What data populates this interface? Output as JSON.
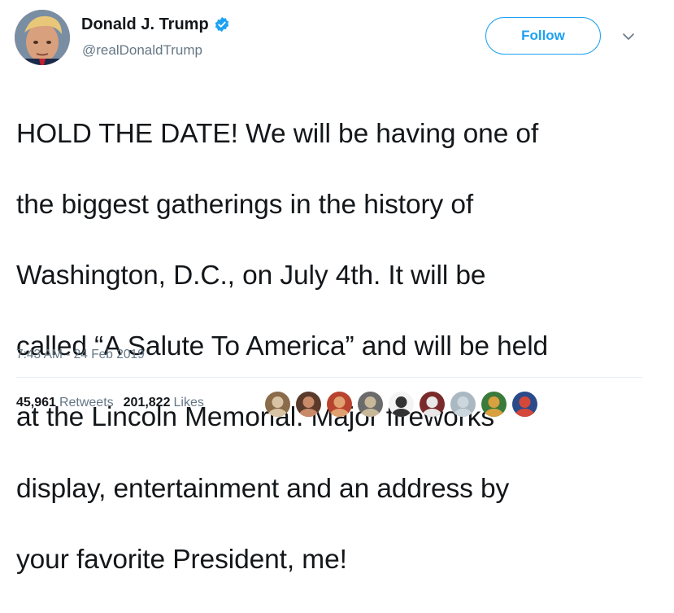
{
  "tweet": {
    "display_name": "Donald J. Trump",
    "handle": "@realDonaldTrump",
    "follow_label": "Follow",
    "text_lines": [
      "HOLD THE DATE! We will be having one of",
      "the biggest gatherings in the history of",
      "Washington, D.C., on July 4th. It will be",
      "called “A Salute To America” and will be held",
      "at the Lincoln Memorial. Major fireworks",
      "display, entertainment and an address by",
      "your favorite President, me!"
    ],
    "timestamp": "7:43 AM - 24 Feb 2019",
    "retweets_count": "45,961",
    "retweets_label": "Retweets",
    "likes_count": "201,822",
    "likes_label": "Likes"
  },
  "colors": {
    "accent": "#1da1f2",
    "text": "#14171a",
    "secondary_text": "#657786",
    "divider": "#e6ecf0"
  },
  "icons": {
    "verified": "verified-badge-icon",
    "caret": "chevron-down-icon"
  },
  "liker_avatars": [
    {
      "palette": [
        "#8a6b4a",
        "#d9c3a5"
      ]
    },
    {
      "palette": [
        "#5a3a2a",
        "#c98a6a"
      ]
    },
    {
      "palette": [
        "#b8432e",
        "#e0a070"
      ]
    },
    {
      "palette": [
        "#6b6b6b",
        "#c8b89a"
      ]
    },
    {
      "palette": [
        "#f4f4f4",
        "#333333"
      ]
    },
    {
      "palette": [
        "#7a2a2a",
        "#e8e8e8"
      ]
    },
    {
      "palette": [
        "#aab8c2",
        "#ccd6dd"
      ]
    },
    {
      "palette": [
        "#3a7a3a",
        "#d9a040"
      ]
    },
    {
      "palette": [
        "#2a4a8a",
        "#d4483a"
      ]
    }
  ]
}
